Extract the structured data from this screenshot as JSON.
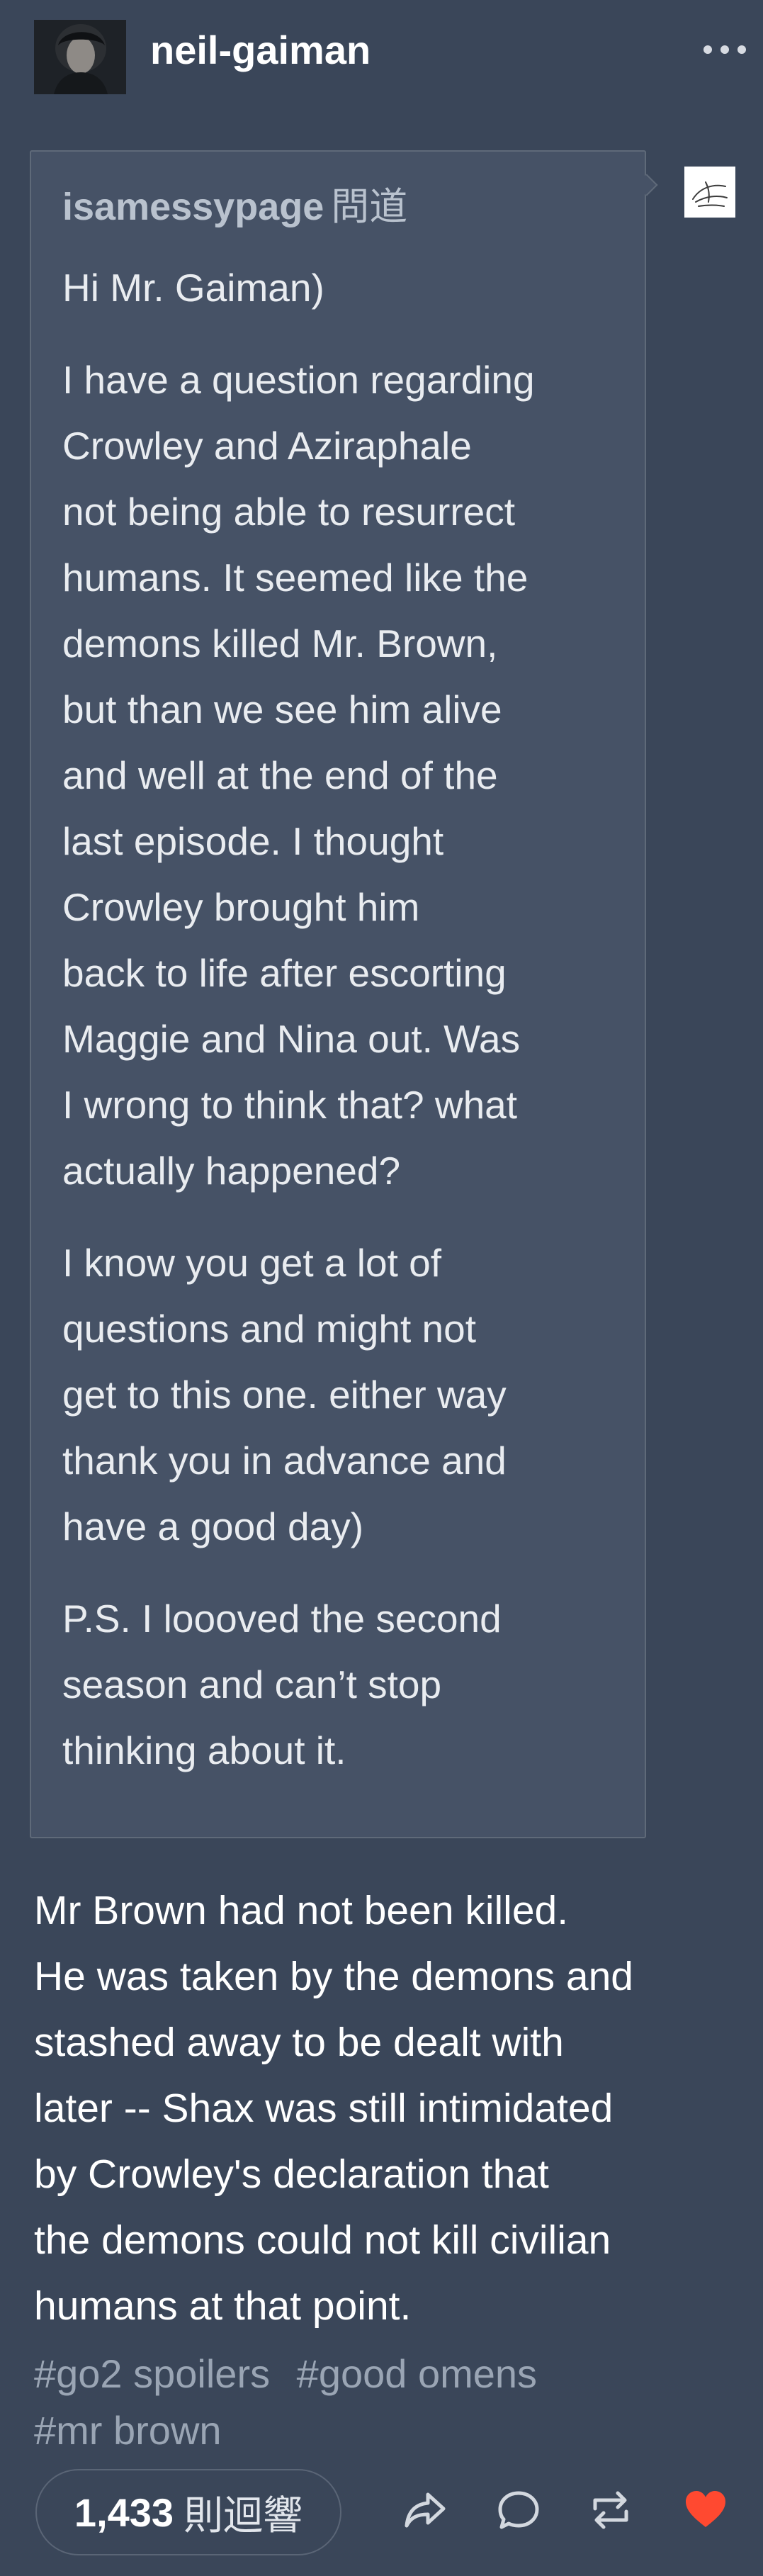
{
  "header": {
    "blog_name": "neil-gaiman",
    "avatar_icon": "author-avatar",
    "more_icon": "ellipsis-icon"
  },
  "ask": {
    "asker": "isamessypage",
    "asker_suffix": "問道",
    "paragraphs": [
      [
        "Hi Mr. Gaiman)"
      ],
      [
        "I have a question regarding",
        "Crowley and Aziraphale",
        "not being able to resurrect",
        "humans. It seemed like the",
        "demons killed Mr. Brown,",
        "but than we see him alive",
        "and well at the end of the",
        "last episode. I thought",
        "Crowley brought him",
        "back to life after escorting",
        "Maggie and Nina out. Was",
        "I wrong to think that? what",
        "actually happened?"
      ],
      [
        "I know you get a lot of",
        "questions and might not",
        "get to this one. either way",
        "thank you in advance and",
        "have a good day)"
      ],
      [
        "P.S. I loooved the second",
        "season and can’t stop",
        "thinking about it."
      ]
    ]
  },
  "answer": {
    "lines": [
      "Mr Brown had not been killed.",
      "He was taken by the demons and",
      "stashed away to be dealt with",
      "later -- Shax was still intimidated",
      "by Crowley's declaration that",
      "the demons could not kill civilian",
      "humans at that point."
    ]
  },
  "tags": [
    "#go2 spoilers",
    "#good omens",
    "#mr brown"
  ],
  "footer": {
    "notes_count": "1,433",
    "notes_label": "則迴響",
    "heart_color": "#ff4930"
  }
}
